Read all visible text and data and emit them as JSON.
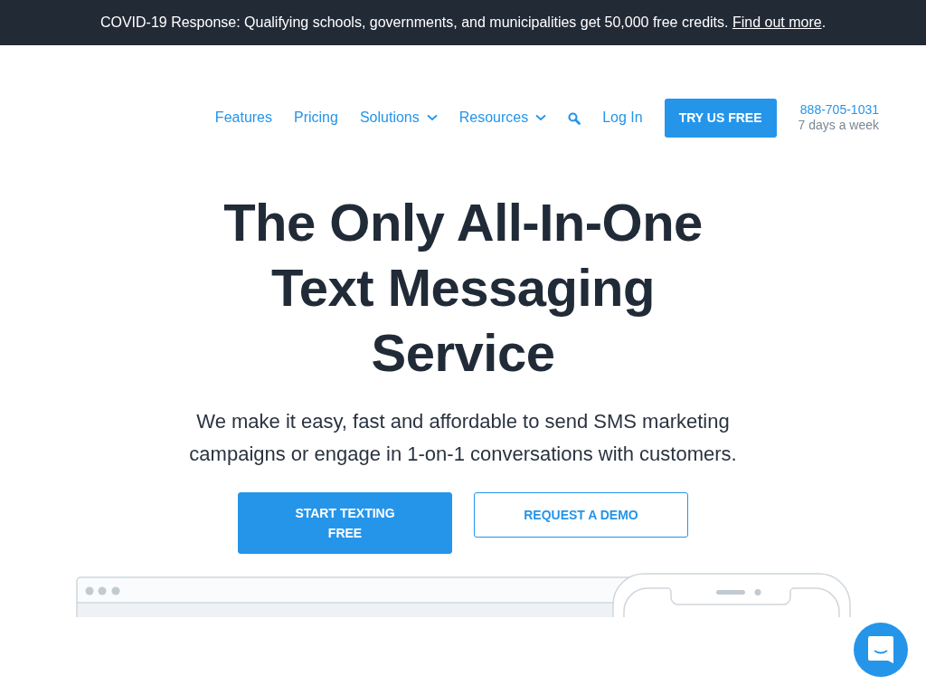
{
  "banner": {
    "text": "COVID-19 Response: Qualifying schools, governments, and municipalities get 50,000 free credits.",
    "link": "Find out more",
    "after": "."
  },
  "nav": {
    "items": [
      {
        "label": "Features",
        "kind": "link"
      },
      {
        "label": "Pricing",
        "kind": "link"
      },
      {
        "label": "Solutions",
        "kind": "dropdown"
      },
      {
        "label": "Resources",
        "kind": "dropdown"
      }
    ],
    "login": "Log In",
    "cta": "TRY US FREE",
    "phone": "888-705-1031",
    "hours": "7 days a week"
  },
  "hero": {
    "title": "The Only All-In-One Text Messaging Service",
    "subtitle": "We make it easy, fast and affordable to send SMS marketing campaigns or engage in 1-on-1 conversations with customers.",
    "buttons": [
      {
        "label": "START TEXTING FREE",
        "kind": "primary"
      },
      {
        "label": "REQUEST A DEMO",
        "kind": "outline"
      }
    ]
  }
}
